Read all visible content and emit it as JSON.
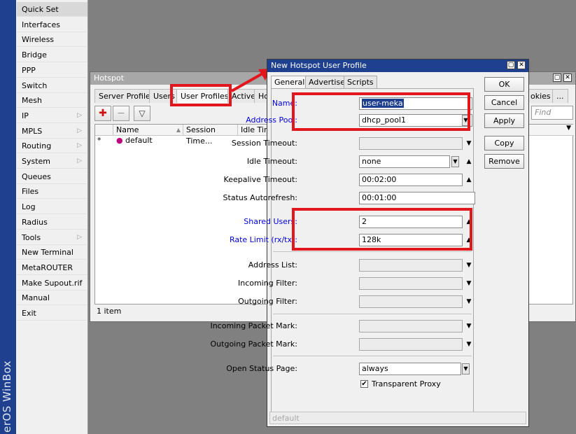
{
  "sidebar": {
    "brand": "erOS WinBox",
    "items": [
      {
        "label": "Quick Set",
        "arrow": false
      },
      {
        "label": "Interfaces",
        "arrow": false
      },
      {
        "label": "Wireless",
        "arrow": false
      },
      {
        "label": "Bridge",
        "arrow": false
      },
      {
        "label": "PPP",
        "arrow": false
      },
      {
        "label": "Switch",
        "arrow": false
      },
      {
        "label": "Mesh",
        "arrow": false
      },
      {
        "label": "IP",
        "arrow": true
      },
      {
        "label": "MPLS",
        "arrow": true
      },
      {
        "label": "Routing",
        "arrow": true
      },
      {
        "label": "System",
        "arrow": true
      },
      {
        "label": "Queues",
        "arrow": false
      },
      {
        "label": "Files",
        "arrow": false
      },
      {
        "label": "Log",
        "arrow": false
      },
      {
        "label": "Radius",
        "arrow": false
      },
      {
        "label": "Tools",
        "arrow": true
      },
      {
        "label": "New Terminal",
        "arrow": false
      },
      {
        "label": "MetaROUTER",
        "arrow": false
      },
      {
        "label": "Make Supout.rif",
        "arrow": false
      },
      {
        "label": "Manual",
        "arrow": false
      },
      {
        "label": "Exit",
        "arrow": false
      }
    ]
  },
  "hotspot": {
    "title": "Hotspot",
    "tabs": [
      "Server Profiles",
      "Users",
      "User Profiles",
      "Active",
      "Ho",
      "okies",
      "..."
    ],
    "find_placeholder": "Find",
    "columns": [
      "Name",
      "Session Time...",
      "Idle Time"
    ],
    "rows": [
      {
        "marker": "*",
        "name": "default"
      }
    ],
    "status": "1 item"
  },
  "dialog": {
    "title": "New Hotspot User Profile",
    "tabs": [
      "General",
      "Advertise",
      "Scripts"
    ],
    "buttons": {
      "ok": "OK",
      "cancel": "Cancel",
      "apply": "Apply",
      "copy": "Copy",
      "remove": "Remove"
    },
    "fields": {
      "name": {
        "label": "Name:",
        "value": "user-meka"
      },
      "address_pool": {
        "label": "Address Pool:",
        "value": "dhcp_pool1"
      },
      "session_timeout": {
        "label": "Session Timeout:",
        "value": ""
      },
      "idle_timeout": {
        "label": "Idle Timeout:",
        "value": "none"
      },
      "keepalive_timeout": {
        "label": "Keepalive Timeout:",
        "value": "00:02:00"
      },
      "status_autorefresh": {
        "label": "Status Autorefresh:",
        "value": "00:01:00"
      },
      "shared_users": {
        "label": "Shared Users:",
        "value": "2"
      },
      "rate_limit": {
        "label": "Rate Limit (rx/tx):",
        "value": "128k"
      },
      "address_list": {
        "label": "Address List:",
        "value": ""
      },
      "incoming_filter": {
        "label": "Incoming Filter:",
        "value": ""
      },
      "outgoing_filter": {
        "label": "Outgoing Filter:",
        "value": ""
      },
      "incoming_packet_mark": {
        "label": "Incoming Packet Mark:",
        "value": ""
      },
      "outgoing_packet_mark": {
        "label": "Outgoing Packet Mark:",
        "value": ""
      },
      "open_status_page": {
        "label": "Open Status Page:",
        "value": "always"
      }
    },
    "transparent_proxy": {
      "label": "Transparent Proxy",
      "checked": true
    },
    "status": "default"
  },
  "colors": {
    "highlight_red": "#e2171e",
    "title_blue": "#1f3f8f",
    "label_blue": "#0000e0"
  }
}
